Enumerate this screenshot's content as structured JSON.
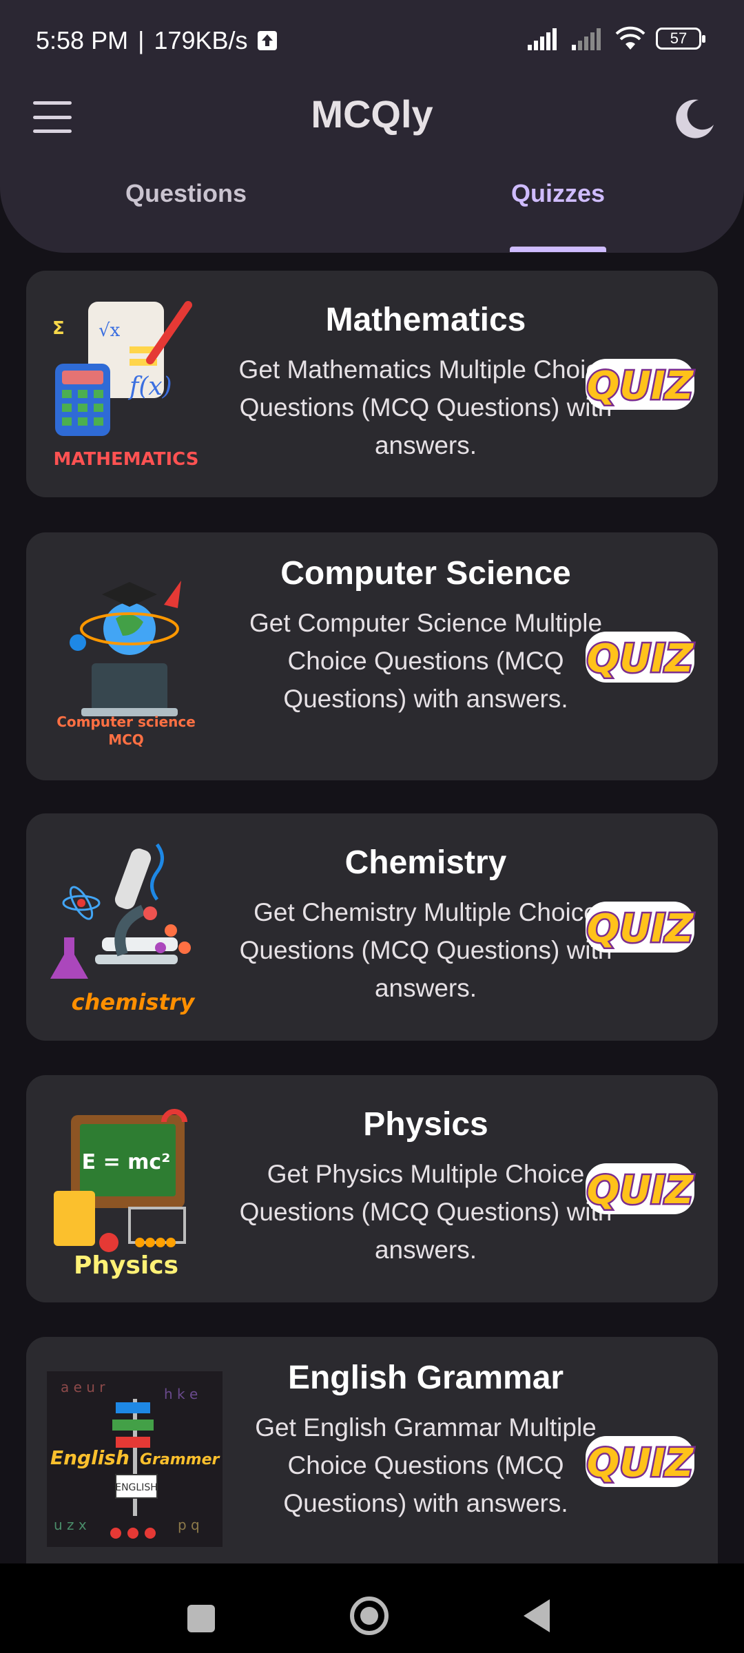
{
  "status": {
    "time": "5:58 PM",
    "separator": "|",
    "network_speed": "179KB/s",
    "battery": "57"
  },
  "appbar": {
    "title": "MCQly",
    "menu_icon": "hamburger-menu-icon",
    "theme_icon": "moon-icon"
  },
  "tabs": [
    {
      "label": "Questions",
      "selected": false
    },
    {
      "label": "Quizzes",
      "selected": true
    }
  ],
  "cards": [
    {
      "title": "Mathematics",
      "description": "Get Mathematics Multiple Choice Questions (MCQ Questions) with answers.",
      "image_caption": "MATHEMATICS",
      "badge": "QUIZ"
    },
    {
      "title": "Computer Science",
      "description": "Get Computer Science Multiple Choice Questions (MCQ Questions) with answers.",
      "image_caption": "Computer science MCQ",
      "badge": "QUIZ"
    },
    {
      "title": "Chemistry",
      "description": "Get Chemistry Multiple Choice Questions (MCQ Questions) with answers.",
      "image_caption": "chemistry",
      "badge": "QUIZ"
    },
    {
      "title": "Physics",
      "description": "Get Physics Multiple Choice Questions (MCQ Questions) with answers.",
      "image_caption": "Physics",
      "badge": "QUIZ"
    },
    {
      "title": "English Grammar",
      "description": "Get English Grammar Multiple Choice Questions (MCQ Questions) with answers.",
      "image_caption": "English Grammer",
      "badge": "QUIZ"
    }
  ],
  "colors": {
    "background": "#141218",
    "header": "#2b2733",
    "card": "#2b2a2f",
    "accent": "#cfbcff",
    "quiz_yellow": "#ffc21a",
    "quiz_purple": "#7b2d8e"
  }
}
